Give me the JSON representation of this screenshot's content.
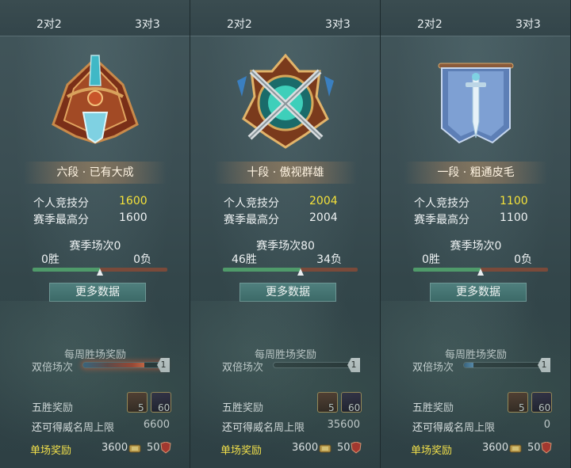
{
  "panels": [
    {
      "tabs": [
        "2对2",
        "3对3"
      ],
      "emblem": "rank-6-emblem",
      "rank_name": "六段 · 已有大成",
      "rating_label": "个人竞技分",
      "rating_value": "1600",
      "season_best_label": "赛季最高分",
      "season_best_value": "1600",
      "season_matches": "赛季场次0",
      "wins": "0胜",
      "losses": "0负",
      "win_ratio": 0.5,
      "more_button": "更多数据",
      "weekly_title": "每周胜场奖励",
      "double_label": "双倍场次",
      "double_count": "1",
      "double_fill": 0.75,
      "five_win_label": "五胜奖励",
      "chest_count": "5",
      "gem_count": "60",
      "limit_label": "还可得威名周上限",
      "limit_value": "6600",
      "single_label": "单场奖励",
      "single_coin": "3600",
      "single_honor": "50"
    },
    {
      "tabs": [
        "2对2",
        "3对3"
      ],
      "emblem": "rank-10-emblem",
      "rank_name": "十段 · 傲视群雄",
      "rating_label": "个人竞技分",
      "rating_value": "2004",
      "season_best_label": "赛季最高分",
      "season_best_value": "2004",
      "season_matches": "赛季场次80",
      "wins": "46胜",
      "losses": "34负",
      "win_ratio": 0.575,
      "more_button": "更多数据",
      "weekly_title": "每周胜场奖励",
      "double_label": "双倍场次",
      "double_count": "1",
      "double_fill": 0.0,
      "five_win_label": "五胜奖励",
      "chest_count": "5",
      "gem_count": "60",
      "limit_label": "还可得威名周上限",
      "limit_value": "35600",
      "single_label": "单场奖励",
      "single_coin": "3600",
      "single_honor": "50"
    },
    {
      "tabs": [
        "2对2",
        "3对3"
      ],
      "emblem": "rank-1-emblem",
      "rank_name": "一段 · 粗通皮毛",
      "rating_label": "个人竞技分",
      "rating_value": "1100",
      "season_best_label": "赛季最高分",
      "season_best_value": "1100",
      "season_matches": "赛季场次0",
      "wins": "0胜",
      "losses": "0负",
      "win_ratio": 0.5,
      "more_button": "更多数据",
      "weekly_title": "每周胜场奖励",
      "double_label": "双倍场次",
      "double_count": "1",
      "double_fill": 0.12,
      "five_win_label": "五胜奖励",
      "chest_count": "5",
      "gem_count": "60",
      "limit_label": "还可得威名周上限",
      "limit_value": "0",
      "single_label": "单场奖励",
      "single_coin": "3600",
      "single_honor": "50"
    }
  ],
  "colors": {
    "rating_highlight": "#f5e23a",
    "single_reward_label": "#f2e04a",
    "win_bar": "#4f9a6a",
    "loss_bar": "#7a4a3a"
  }
}
